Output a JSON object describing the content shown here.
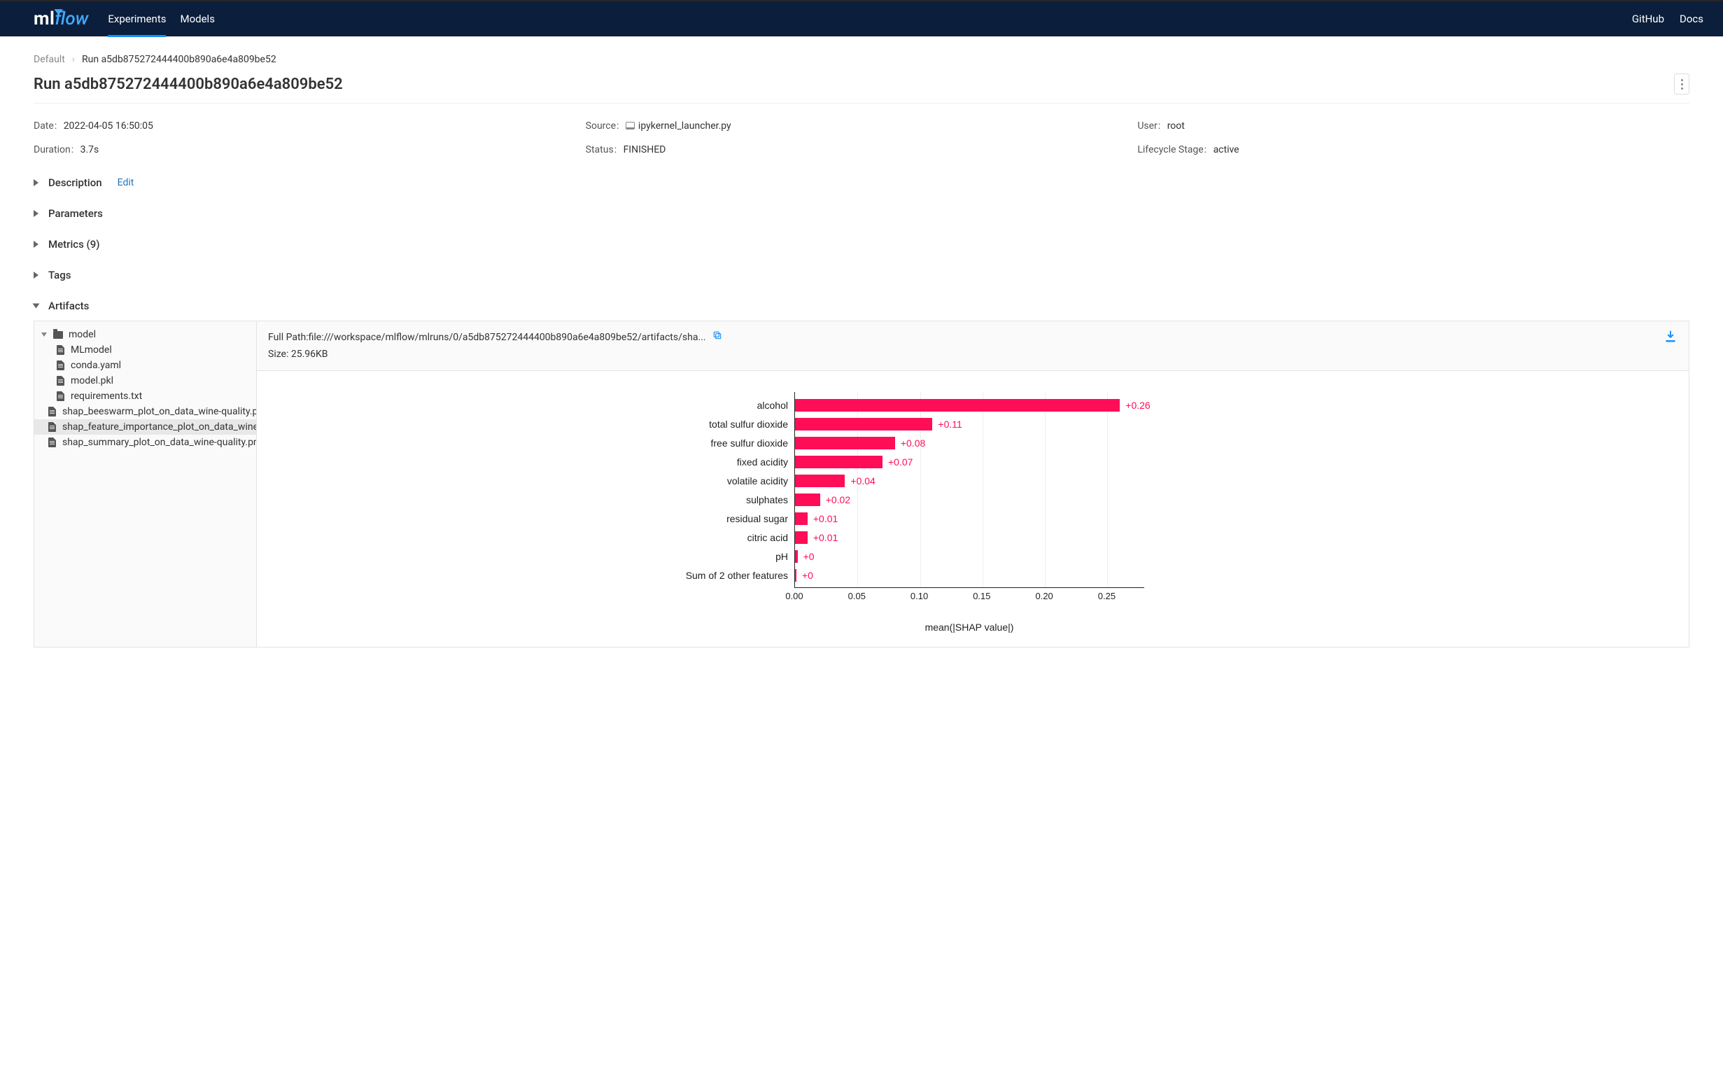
{
  "header": {
    "nav": {
      "experiments": "Experiments",
      "models": "Models"
    },
    "right": {
      "github": "GitHub",
      "docs": "Docs"
    }
  },
  "breadcrumb": {
    "root": "Default",
    "current": "Run a5db875272444400b890a6e4a809be52"
  },
  "title": "Run a5db875272444400b890a6e4a809be52",
  "meta": {
    "date_k": "Date",
    "date_v": "2022-04-05 16:50:05",
    "source_k": "Source",
    "source_v": "ipykernel_launcher.py",
    "user_k": "User",
    "user_v": "root",
    "duration_k": "Duration",
    "duration_v": "3.7s",
    "status_k": "Status",
    "status_v": "FINISHED",
    "stage_k": "Lifecycle Stage",
    "stage_v": "active"
  },
  "sections": {
    "description": "Description",
    "edit": "Edit",
    "parameters": "Parameters",
    "metrics": "Metrics (9)",
    "tags": "Tags",
    "artifacts": "Artifacts"
  },
  "tree": {
    "folder": "model",
    "files": [
      "MLmodel",
      "conda.yaml",
      "model.pkl",
      "requirements.txt"
    ],
    "root_files": [
      "shap_beeswarm_plot_on_data_wine-quality.png",
      "shap_feature_importance_plot_on_data_wine-qualit",
      "shap_summary_plot_on_data_wine-quality.png"
    ],
    "selected_index": 1
  },
  "artifact": {
    "full_path_label": "Full Path:",
    "full_path": "file:///workspace/mlflow/mlruns/0/a5db875272444400b890a6e4a809be52/artifacts/sha...",
    "size_label": "Size:",
    "size": "25.96KB"
  },
  "chart_data": {
    "type": "bar",
    "orientation": "horizontal",
    "xlabel": "mean(|SHAP value|)",
    "xlim": [
      0.0,
      0.28
    ],
    "xticks": [
      0.0,
      0.05,
      0.1,
      0.15,
      0.2,
      0.25
    ],
    "categories": [
      "alcohol",
      "total sulfur dioxide",
      "free sulfur dioxide",
      "fixed acidity",
      "volatile acidity",
      "sulphates",
      "residual sugar",
      "citric acid",
      "pH",
      "Sum of 2 other features"
    ],
    "values": [
      0.26,
      0.11,
      0.08,
      0.07,
      0.04,
      0.02,
      0.01,
      0.01,
      0.002,
      0.001
    ],
    "labels": [
      "+0.26",
      "+0.11",
      "+0.08",
      "+0.07",
      "+0.04",
      "+0.02",
      "+0.01",
      "+0.01",
      "+0",
      "+0"
    ],
    "color": "#ff0d57"
  }
}
